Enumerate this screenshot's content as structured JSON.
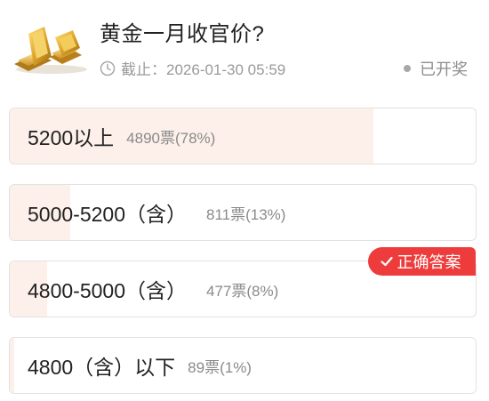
{
  "poll": {
    "title": "黄金一月收官价?",
    "deadline": "截止：2026-01-30 05:59",
    "status": "已开奖",
    "correct_badge": "正确答案",
    "options": [
      {
        "label": "5200以上",
        "votes": "4890票(78%)",
        "percent": 78
      },
      {
        "label": "5000-5200（含）",
        "votes": "811票(13%)",
        "percent": 13
      },
      {
        "label": "4800-5000（含）",
        "votes": "477票(8%)",
        "percent": 8
      },
      {
        "label": "4800（含）以下",
        "votes": "89票(1%)",
        "percent": 1
      }
    ]
  },
  "icons": {
    "clock": "clock-icon",
    "check": "check-icon",
    "thumbnail": "gold-bars-image"
  },
  "colors": {
    "fill": "#fdf0ea",
    "badge": "#ee3b3b",
    "muted_text": "#9a9a9a"
  }
}
